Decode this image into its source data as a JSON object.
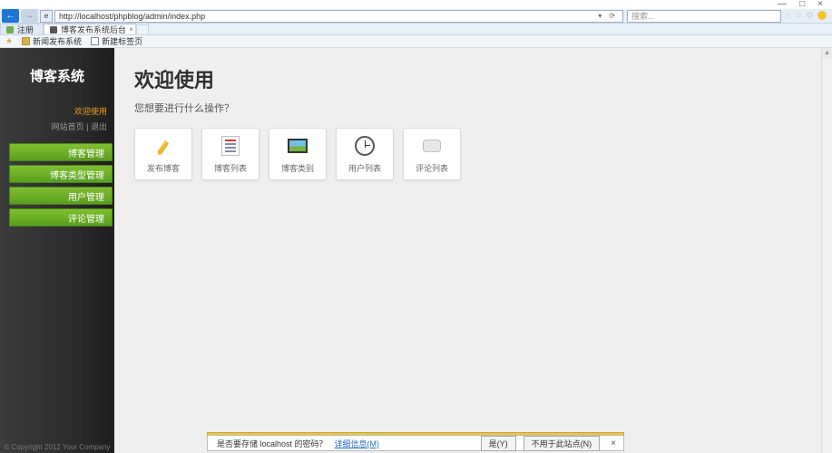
{
  "window": {
    "min": "—",
    "max": "□",
    "close": "×"
  },
  "browser": {
    "url": "http://localhost/phpblog/admin/index.php",
    "search_placeholder": "搜索...",
    "refresh": "⟳"
  },
  "tabs": {
    "t1": "注册",
    "t2": "博客发布系统后台"
  },
  "bookmarks": {
    "b1": "新闻发布系统",
    "b2": "新建标签页"
  },
  "sidebar": {
    "logo": "博客系统",
    "crumb1": "欢迎使用",
    "crumb2": "网站首页 | 退出",
    "items": [
      "博客管理",
      "博客类型管理",
      "用户管理",
      "评论管理"
    ],
    "copyright": "© Copyright 2012 Your Company"
  },
  "main": {
    "welcome": "欢迎使用",
    "subtitle": "您想要进行什么操作？",
    "tiles": [
      {
        "label": "发布博客"
      },
      {
        "label": "博客列表"
      },
      {
        "label": "博客类别"
      },
      {
        "label": "用户列表"
      },
      {
        "label": "评论列表"
      }
    ]
  },
  "notify": {
    "msg": "是否要存储 localhost 的密码？",
    "link": "详细信息(M)",
    "yes": "是(Y)",
    "no": "不用于此站点(N)"
  }
}
